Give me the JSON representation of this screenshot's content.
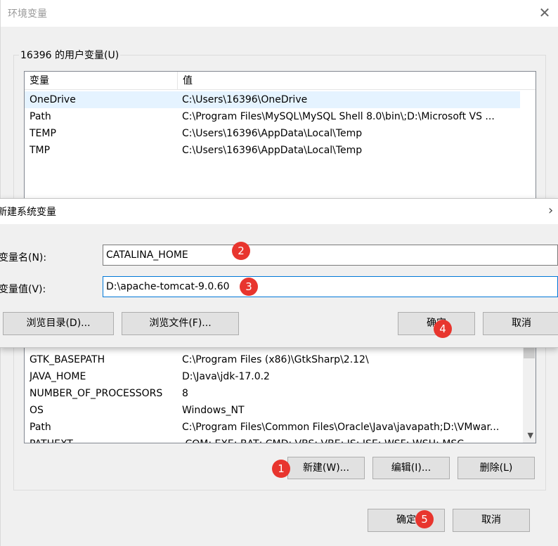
{
  "env_dialog": {
    "title": "环境变量",
    "user_group_label": "16396 的用户变量(U)",
    "user_columns": [
      "变量",
      "值"
    ],
    "user_rows": [
      {
        "name": "OneDrive",
        "value": "C:\\Users\\16396\\OneDrive"
      },
      {
        "name": "Path",
        "value": "C:\\Program Files\\MySQL\\MySQL Shell 8.0\\bin\\;D:\\Microsoft VS ..."
      },
      {
        "name": "TEMP",
        "value": "C:\\Users\\16396\\AppData\\Local\\Temp"
      },
      {
        "name": "TMP",
        "value": "C:\\Users\\16396\\AppData\\Local\\Temp"
      }
    ],
    "system_rows": [
      {
        "name": "GTK_BASEPATH",
        "value": "C:\\Program Files (x86)\\GtkSharp\\2.12\\"
      },
      {
        "name": "JAVA_HOME",
        "value": "D:\\Java\\jdk-17.0.2"
      },
      {
        "name": "NUMBER_OF_PROCESSORS",
        "value": "8"
      },
      {
        "name": "OS",
        "value": "Windows_NT"
      },
      {
        "name": "Path",
        "value": "C:\\Program Files\\Common Files\\Oracle\\Java\\javapath;D:\\VMwar..."
      },
      {
        "name": "PATHEXT",
        "value": ".COM;.EXE;.BAT;.CMD;.VBS;.VBE;.JS;.JSE;.WSF;.WSH;.MSC"
      }
    ],
    "system_buttons": {
      "new": "新建(W)...",
      "edit": "编辑(I)...",
      "delete": "删除(L)"
    },
    "footer_buttons": {
      "ok": "确定",
      "cancel": "取消"
    }
  },
  "new_var_dialog": {
    "title": "新建系统变量",
    "name_label": "变量名(N):",
    "name_value": "CATALINA_HOME",
    "value_label": "变量值(V):",
    "value_value": "D:\\apache-tomcat-9.0.60",
    "browse_dir": "浏览目录(D)...",
    "browse_file": "浏览文件(F)...",
    "ok": "确定",
    "cancel": "取消"
  },
  "badges": [
    "1",
    "2",
    "3",
    "4",
    "5"
  ],
  "colors": {
    "badge": "#e8352e",
    "focus": "#0078d7",
    "selected_row": "#e5f3ff"
  }
}
